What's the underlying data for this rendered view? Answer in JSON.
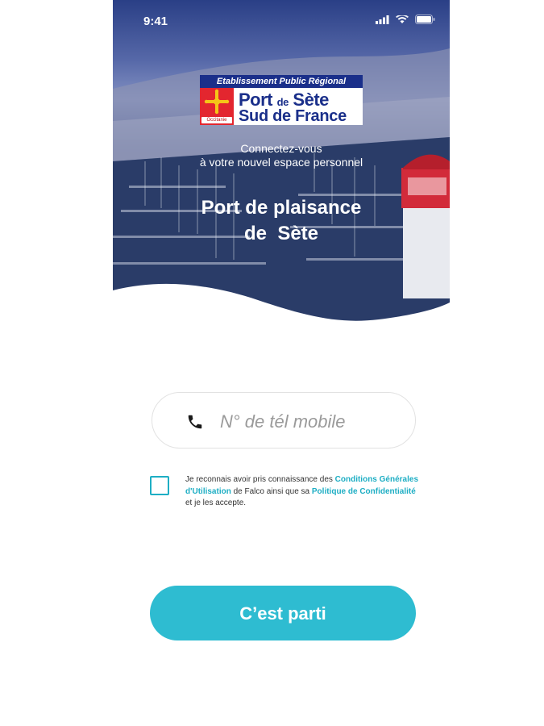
{
  "status_bar": {
    "time": "9:41"
  },
  "hero": {
    "logo": {
      "band": "Etablissement Public Régional",
      "line1_a": "Port",
      "line1_b": "de",
      "line1_c": "Sète",
      "line2": "Sud de France",
      "badge_text": "Occitanie"
    },
    "subtitle_line1": "Connectez-vous",
    "subtitle_line2": "à votre nouvel espace personnel",
    "title_line1": "Port de plaisance",
    "title_line2": "de  Sète"
  },
  "phone_field": {
    "placeholder": "N° de tél mobile",
    "icon": "phone-icon"
  },
  "consent": {
    "checked": false,
    "text_1": "Je reconnais avoir pris connaissance des ",
    "link_1": "Conditions Générales d'Utilisation",
    "text_2": " de Falco ainsi que sa ",
    "link_2": "Politique de Confidentialité",
    "text_3": " et je les accepte."
  },
  "cta": {
    "label": "C’est parti"
  },
  "colors": {
    "accent": "#2ebcd1",
    "brand_blue": "#1a2f8a",
    "brand_red": "#e3262f"
  }
}
